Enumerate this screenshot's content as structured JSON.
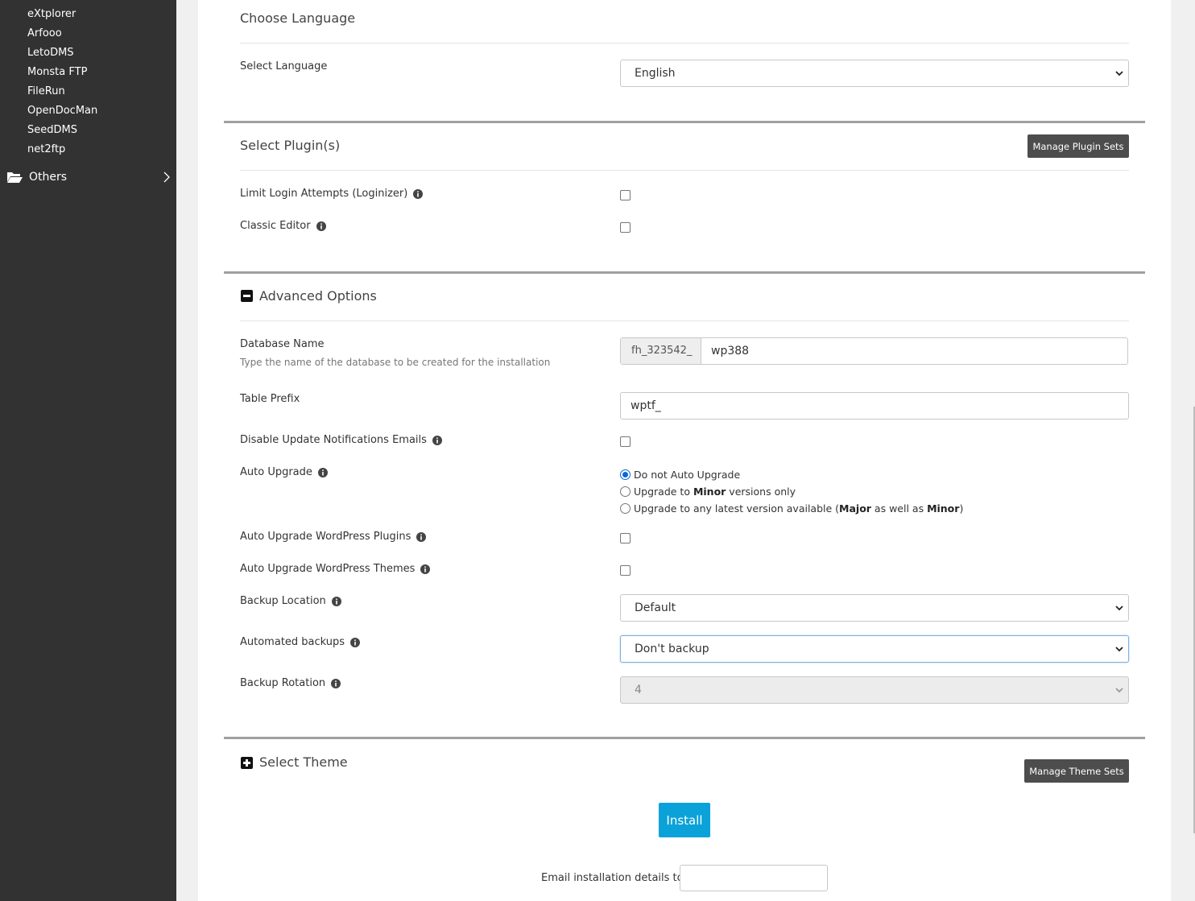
{
  "sidebar": {
    "cut_item": "...",
    "items": [
      "eXtplorer",
      "Arfooo",
      "LetoDMS",
      "Monsta FTP",
      "FileRun",
      "OpenDocMan",
      "SeedDMS",
      "net2ftp"
    ],
    "others_label": "Others"
  },
  "language_section": {
    "title": "Choose Language",
    "select_label": "Select Language",
    "selected": "English"
  },
  "plugins_section": {
    "title": "Select Plugin(s)",
    "manage_button": "Manage Plugin Sets",
    "plugins": [
      {
        "label": "Limit Login Attempts (Loginizer)",
        "checked": false
      },
      {
        "label": "Classic Editor",
        "checked": false
      }
    ]
  },
  "advanced_section": {
    "title": "Advanced Options",
    "db_name_label": "Database Name",
    "db_name_help": "Type the name of the database to be created for the installation",
    "db_prefix": "fh_323542_",
    "db_name_value": "wp388",
    "table_prefix_label": "Table Prefix",
    "table_prefix_value": "wptf_",
    "disable_update_label": "Disable Update Notifications Emails",
    "auto_upgrade_label": "Auto Upgrade",
    "auto_upgrade_options": {
      "opt1": "Do not Auto Upgrade",
      "opt2_pre": "Upgrade to ",
      "opt2_bold": "Minor",
      "opt2_post": " versions only",
      "opt3_pre": "Upgrade to any latest version available (",
      "opt3_bold1": "Major",
      "opt3_mid": " as well as ",
      "opt3_bold2": "Minor",
      "opt3_post": ")",
      "selected": 1
    },
    "auto_upgrade_plugins_label": "Auto Upgrade WordPress Plugins",
    "auto_upgrade_themes_label": "Auto Upgrade WordPress Themes",
    "backup_location_label": "Backup Location",
    "backup_location_value": "Default",
    "automated_backups_label": "Automated backups",
    "automated_backups_value": "Don't backup",
    "backup_rotation_label": "Backup Rotation",
    "backup_rotation_value": "4"
  },
  "theme_section": {
    "title": "Select Theme",
    "manage_button": "Manage Theme Sets"
  },
  "install_button": "Install",
  "email_label": "Email installation details to :",
  "colors": {
    "sidebar_bg": "#323232",
    "install_bg": "#0aa2d8",
    "dark_button": "#4d4d4d",
    "radio_selected": "#0a66d6"
  }
}
